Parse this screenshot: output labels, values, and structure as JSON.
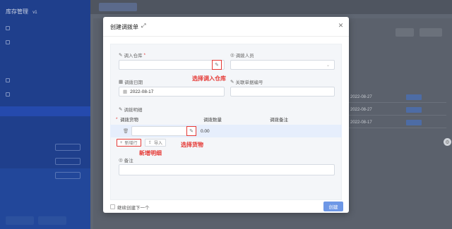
{
  "sidebar": {
    "title": "库存管理",
    "version": "v1"
  },
  "modal": {
    "title": "创建调拨单",
    "fields": {
      "in_warehouse_label": "调入仓库",
      "in_warehouse_required": "*",
      "operator_label": "调拨人员",
      "date_label": "调拨日期",
      "date_value": "2022-08-17",
      "ref_no_label": "关联单据编号",
      "details_label": "调拨明细",
      "remark_label": "备注"
    },
    "table": {
      "headers": [
        "调拨货物",
        "调拨数量",
        "调拨备注"
      ],
      "required_mark": "*",
      "row_qty": "0.00"
    },
    "add_row_label": "新增行",
    "import_label": "导入",
    "continue_label": "继续创建下一个",
    "create_label": "创建"
  },
  "annotations": {
    "select_warehouse": "选择调入仓库",
    "select_goods": "选择货物",
    "add_details": "新增明细"
  },
  "background": {
    "dates": [
      "2022-08-27",
      "2022-08-27",
      "2022-08-17"
    ]
  },
  "colors": {
    "primary": "#6d97e6",
    "annotation_red": "#e53935",
    "sidebar_blue": "#1f3f8c"
  }
}
